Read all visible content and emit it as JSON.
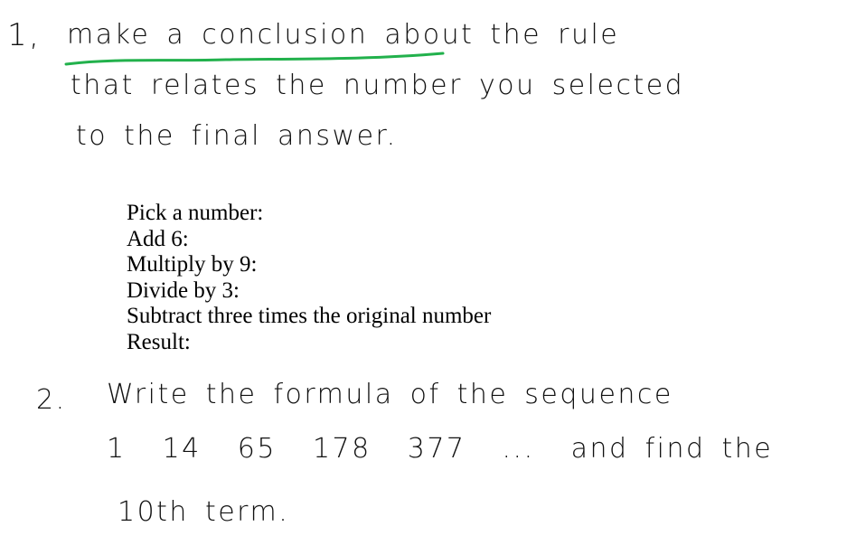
{
  "question1": {
    "number": "1,",
    "lines": [
      [
        "make",
        "a",
        "conclusion",
        "about",
        "the",
        "rule"
      ],
      [
        "that",
        "relates",
        "the",
        "number",
        "you",
        "selected"
      ],
      [
        "to",
        "the",
        "final",
        "answer."
      ]
    ],
    "underlined_text": "make a conclusion",
    "underline_color": "#22b14c"
  },
  "steps": [
    "Pick a number:",
    "Add 6:",
    "Multiply by 9:",
    "Divide by 3:",
    "Subtract three times the original number",
    "Result:"
  ],
  "question2": {
    "number": "2.",
    "line1": [
      "Write",
      "the",
      "formula",
      "of",
      "the",
      "sequence"
    ],
    "sequence": [
      "1",
      "14",
      "65",
      "178",
      "377",
      "..."
    ],
    "line2_tail": [
      "and",
      "find",
      "the"
    ],
    "line3": [
      "10th",
      "term."
    ]
  },
  "colors": {
    "ink": "#111111",
    "highlight": "#22b14c",
    "background": "#ffffff"
  }
}
